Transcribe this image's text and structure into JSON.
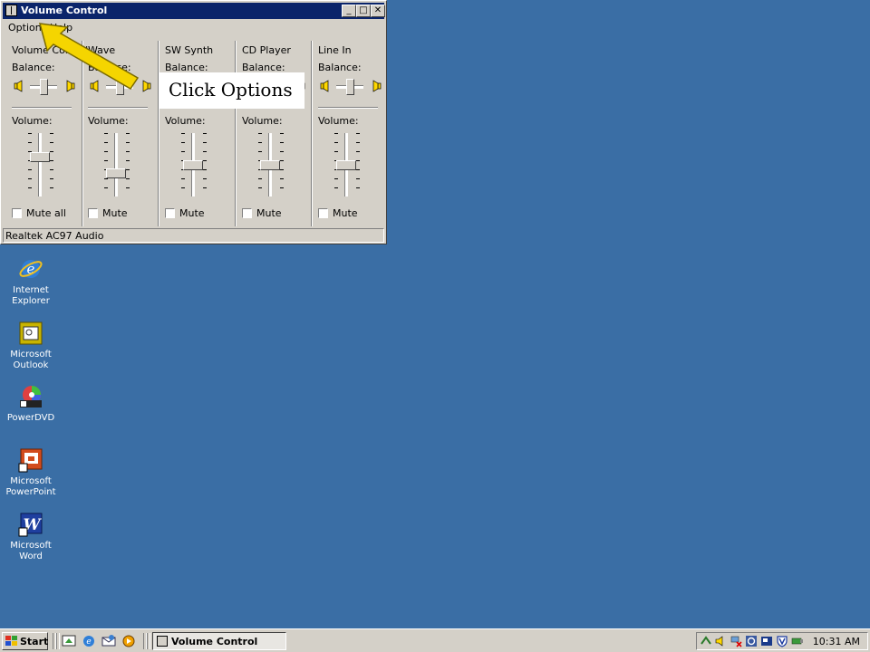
{
  "window": {
    "title": "Volume Control",
    "menus": [
      "Options",
      "Help"
    ],
    "channels": [
      {
        "name": "Volume Control",
        "balance_label": "Balance:",
        "volume_label": "Volume:",
        "mute_label": "Mute all",
        "volume_level": 0.65
      },
      {
        "name": "Wave",
        "balance_label": "Balance:",
        "volume_label": "Volume:",
        "mute_label": "Mute",
        "volume_level": 0.35
      },
      {
        "name": "SW Synth",
        "balance_label": "Balance:",
        "volume_label": "Volume:",
        "mute_label": "Mute",
        "volume_level": 0.5
      },
      {
        "name": "CD Player",
        "balance_label": "Balance:",
        "volume_label": "Volume:",
        "mute_label": "Mute",
        "volume_level": 0.5
      },
      {
        "name": "Line In",
        "balance_label": "Balance:",
        "volume_label": "Volume:",
        "mute_label": "Mute",
        "volume_level": 0.5
      }
    ],
    "status": "Realtek AC97 Audio"
  },
  "callout": {
    "text": "Click Options"
  },
  "desktop_icons": [
    {
      "label_line1": "Internet",
      "label_line2": "Explorer",
      "icon": "internet-explorer-icon"
    },
    {
      "label_line1": "Microsoft",
      "label_line2": "Outlook",
      "icon": "outlook-icon"
    },
    {
      "label_line1": "PowerDVD",
      "label_line2": "",
      "icon": "powerdvd-icon"
    },
    {
      "label_line1": "Microsoft",
      "label_line2": "PowerPoint",
      "icon": "powerpoint-icon"
    },
    {
      "label_line1": "Microsoft",
      "label_line2": "Word",
      "icon": "word-icon"
    }
  ],
  "taskbar": {
    "start_label": "Start",
    "task_label": "Volume Control",
    "clock": "10:31 AM"
  },
  "colors": {
    "desktop": "#3a6ea5",
    "titlebar": "#0a246a",
    "arrow": "#f5d500"
  }
}
